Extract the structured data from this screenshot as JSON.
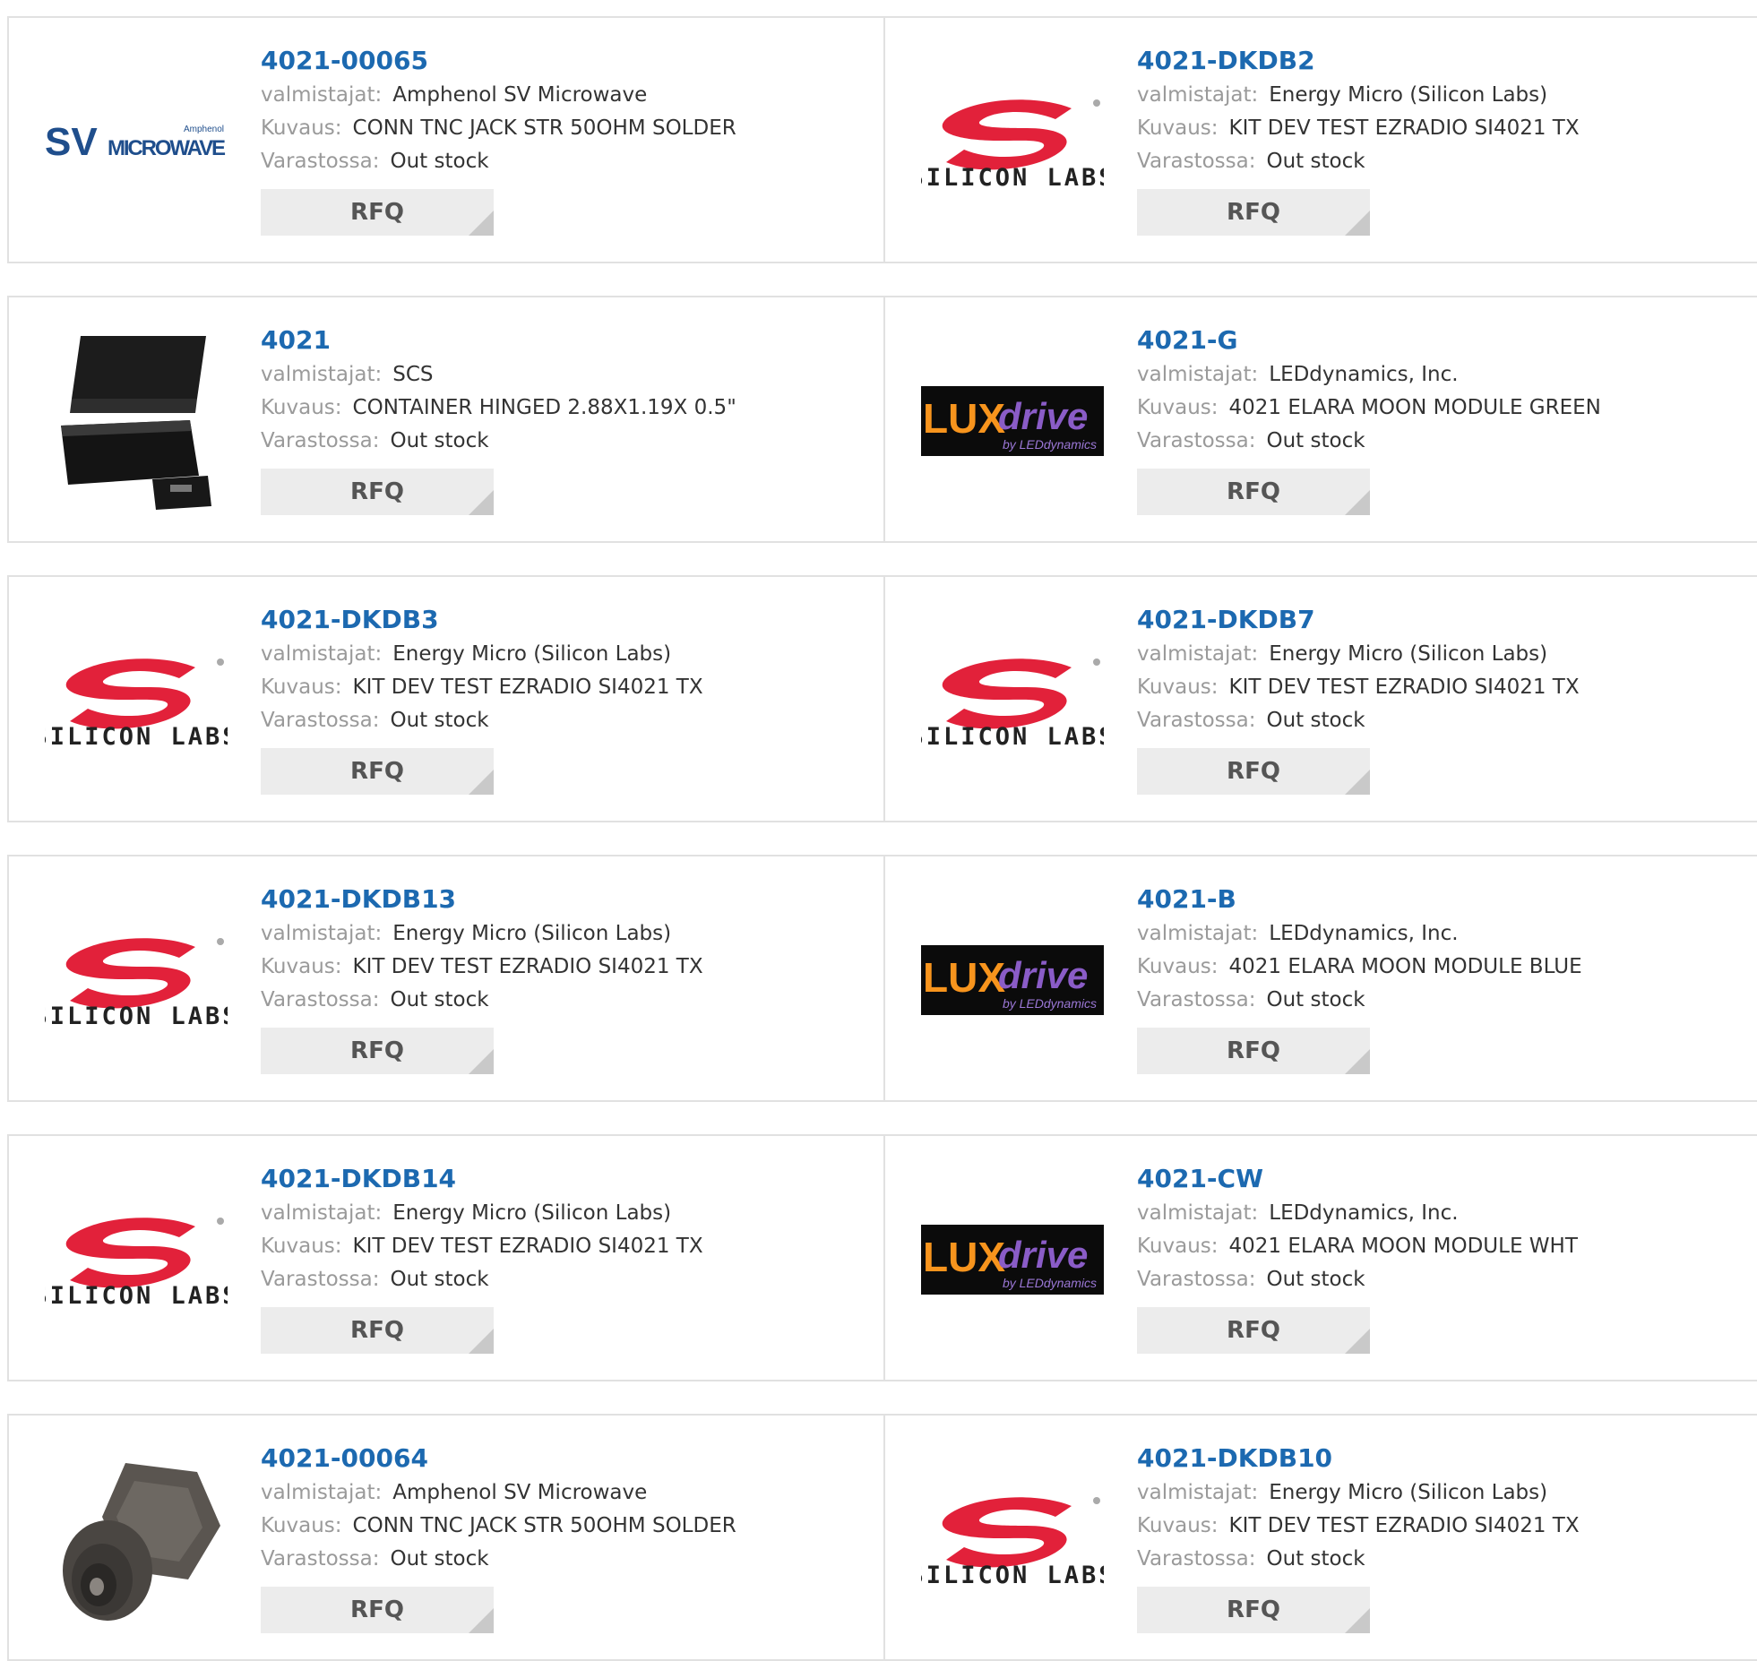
{
  "labels": {
    "manufacturer": "valmistajat:",
    "description": "Kuvaus:",
    "stock": "Varastossa:",
    "rfq": "RFQ"
  },
  "logos": {
    "sv": {
      "main": "SV",
      "sub": "MICROWAVE",
      "small": "Amphenol"
    },
    "silicon": {
      "text": "SILICON LABS"
    },
    "lux": {
      "a": "LUX",
      "b": "drive",
      "sub": "by LEDdynamics"
    }
  },
  "items": [
    {
      "pn": "4021-00065",
      "manufacturer": "Amphenol SV Microwave",
      "description": "CONN TNC JACK STR 50OHM SOLDER",
      "stock": "Out stock",
      "logo": "sv-microwave-logo"
    },
    {
      "pn": "4021-DKDB2",
      "manufacturer": "Energy Micro (Silicon Labs)",
      "description": "KIT DEV TEST EZRADIO SI4021 TX",
      "stock": "Out stock",
      "logo": "silicon-labs-logo"
    },
    {
      "pn": "4021",
      "manufacturer": "SCS",
      "description": "CONTAINER HINGED 2.88X1.19X 0.5\"",
      "stock": "Out stock",
      "logo": "container-photo"
    },
    {
      "pn": "4021-G",
      "manufacturer": "LEDdynamics, Inc.",
      "description": "4021 ELARA MOON MODULE GREEN",
      "stock": "Out stock",
      "logo": "luxdrive-logo"
    },
    {
      "pn": "4021-DKDB3",
      "manufacturer": "Energy Micro (Silicon Labs)",
      "description": "KIT DEV TEST EZRADIO SI4021 TX",
      "stock": "Out stock",
      "logo": "silicon-labs-logo"
    },
    {
      "pn": "4021-DKDB7",
      "manufacturer": "Energy Micro (Silicon Labs)",
      "description": "KIT DEV TEST EZRADIO SI4021 TX",
      "stock": "Out stock",
      "logo": "silicon-labs-logo"
    },
    {
      "pn": "4021-DKDB13",
      "manufacturer": "Energy Micro (Silicon Labs)",
      "description": "KIT DEV TEST EZRADIO SI4021 TX",
      "stock": "Out stock",
      "logo": "silicon-labs-logo"
    },
    {
      "pn": "4021-B",
      "manufacturer": "LEDdynamics, Inc.",
      "description": "4021 ELARA MOON MODULE BLUE",
      "stock": "Out stock",
      "logo": "luxdrive-logo"
    },
    {
      "pn": "4021-DKDB14",
      "manufacturer": "Energy Micro (Silicon Labs)",
      "description": "KIT DEV TEST EZRADIO SI4021 TX",
      "stock": "Out stock",
      "logo": "silicon-labs-logo"
    },
    {
      "pn": "4021-CW",
      "manufacturer": "LEDdynamics, Inc.",
      "description": "4021 ELARA MOON MODULE WHT",
      "stock": "Out stock",
      "logo": "luxdrive-logo"
    },
    {
      "pn": "4021-00064",
      "manufacturer": "Amphenol SV Microwave",
      "description": "CONN TNC JACK STR 50OHM SOLDER",
      "stock": "Out stock",
      "logo": "tnc-connector-photo"
    },
    {
      "pn": "4021-DKDB10",
      "manufacturer": "Energy Micro (Silicon Labs)",
      "description": "KIT DEV TEST EZRADIO SI4021 TX",
      "stock": "Out stock",
      "logo": "silicon-labs-logo"
    }
  ],
  "colors": {
    "link": "#1c69b0",
    "silicon_red": "#e2213a",
    "lux_orange": "#f7941d",
    "lux_purple": "#8a5cc7"
  }
}
